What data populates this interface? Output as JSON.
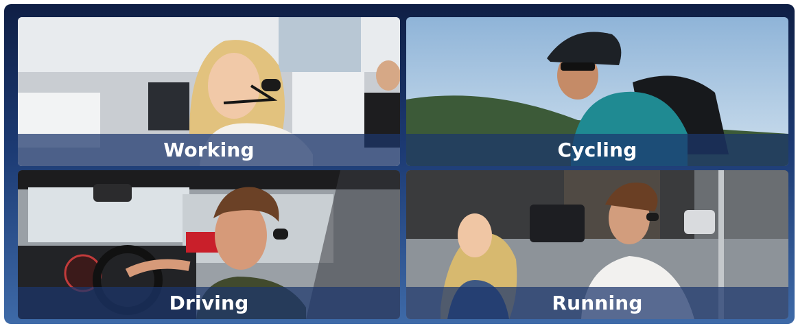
{
  "panels": [
    {
      "label": "Working",
      "scene": "office-headset-woman"
    },
    {
      "label": "Cycling",
      "scene": "cyclist-helmet-headset"
    },
    {
      "label": "Driving",
      "scene": "driver-car-headset"
    },
    {
      "label": "Running",
      "scene": "runners-street-headset"
    }
  ]
}
